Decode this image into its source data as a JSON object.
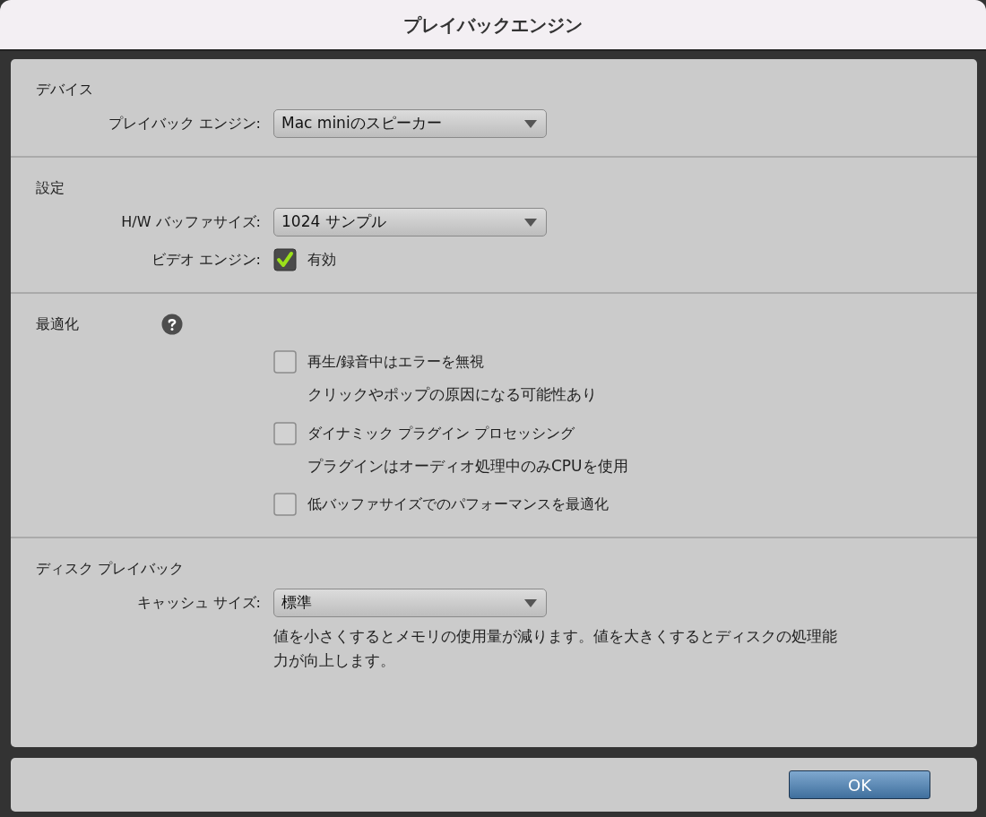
{
  "window": {
    "title": "プレイバックエンジン"
  },
  "sections": [
    {
      "heading": "デバイス",
      "rows": [
        {
          "kind": "select",
          "label": "プレイバック エンジン:",
          "value": "Mac miniのスピーカー"
        }
      ]
    },
    {
      "heading": "設定",
      "rows": [
        {
          "kind": "select",
          "label": "H/W バッファサイズ:",
          "value": "1024 サンプル"
        },
        {
          "kind": "checkbox",
          "label": "ビデオ エンジン:",
          "text": "有効",
          "checked": true
        }
      ]
    },
    {
      "heading": "最適化",
      "help": true,
      "rows": [
        {
          "kind": "option",
          "text": "再生/録音中はエラーを無視",
          "checked": false,
          "note": "クリックやポップの原因になる可能性あり"
        },
        {
          "kind": "option",
          "text": "ダイナミック プラグイン プロセッシング",
          "checked": false,
          "note": "プラグインはオーディオ処理中のみCPUを使用"
        },
        {
          "kind": "option",
          "text": "低バッファサイズでのパフォーマンスを最適化",
          "checked": false
        }
      ]
    },
    {
      "heading": "ディスク プレイバック",
      "rows": [
        {
          "kind": "select",
          "label": "キャッシュ サイズ:",
          "value": "標準",
          "note": "値を小さくするとメモリの使用量が減ります。値を大きくするとディスクの処理能力が向上します。"
        }
      ]
    }
  ],
  "buttons": [
    {
      "label": "OK"
    }
  ]
}
